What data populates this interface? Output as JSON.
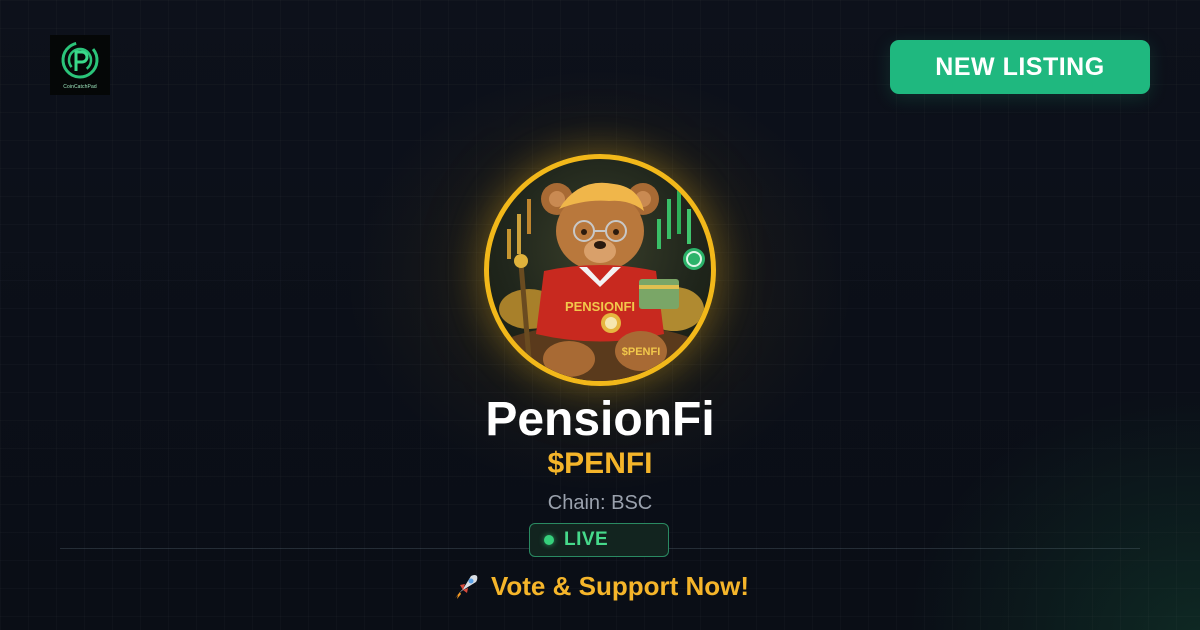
{
  "brand": {
    "logo_text": "CoinCatchPad",
    "logo_icon": "coin-p-logo-icon"
  },
  "badge": {
    "label": "NEW LISTING",
    "color": "#1fb87f"
  },
  "project": {
    "avatar_icon": "teddy-bear-avatar",
    "name": "PensionFi",
    "ticker": "$PENFI",
    "chain_text": "Chain: BSC"
  },
  "status": {
    "label": "LIVE",
    "dot_color": "#36d07c"
  },
  "cta": {
    "icon": "rocket-icon",
    "label": "Vote & Support Now!"
  },
  "colors": {
    "accent_gold": "#f5b52a",
    "ring_gold": "#f2b81a",
    "background": "#0c1019"
  }
}
